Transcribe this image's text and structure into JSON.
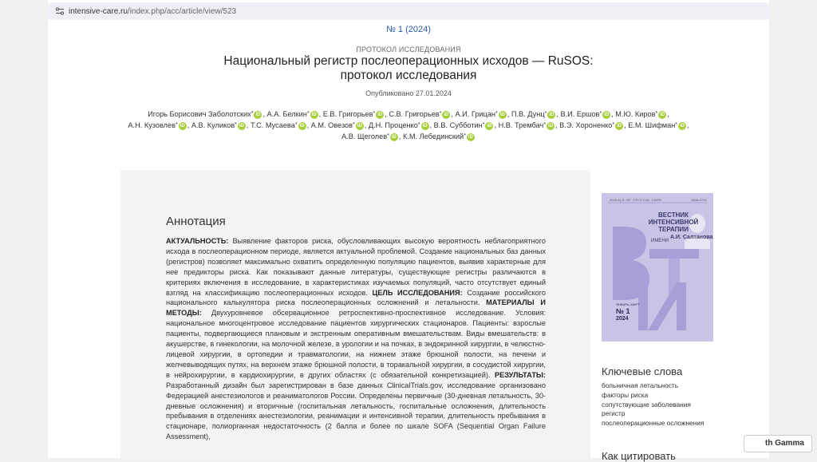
{
  "browser": {
    "url_host": "intensive-care.ru",
    "url_path": "/index.php/acc/article/view/523",
    "tune_icon": "tune-icon"
  },
  "article": {
    "issue": "№ 1 (2024)",
    "section": "ПРОТОКОЛ ИССЛЕДОВАНИЯ",
    "title": "Национальный регистр послеоперационных исходов — RuSOS: протокол исследования",
    "published": "Опубликовано 27.01.2024",
    "authors": [
      "Игорь Борисович Заболотских",
      "А.А. Белкин",
      "Е.В. Григорьев",
      "С.В. Григорьев",
      "А.И. Грицан",
      "П.В. Дунц",
      "В.И. Ершов",
      "М.Ю. Киров",
      "А.Н. Кузовлев",
      "А.В. Куликов",
      "Т.С. Мусаева",
      "А.М. Овезов",
      "Д.Н. Проценко",
      "В.В. Субботин",
      "Н.В. Трембач",
      "В.Э. Хороненко",
      "Е.М. Шифман",
      "А.В. Щеголев",
      "К.М. Лебединский"
    ],
    "orcid_label": "iD"
  },
  "abstract": {
    "heading": "Аннотация",
    "relevance_label": "АКТУАЛЬНОСТЬ:",
    "relevance_text": " Выявление факторов риска, обусловливающих высокую вероятность неблагоприятного исхода в послеоперационном периоде, является актуальной проблемой. Создание национальных баз данных (регистров) позволяет максимально охватить определенную популяцию пациентов, выявив характерные для нее предикторы риска. Как показывают данные литературы, существующие регистры различаются в критериях включения в исследование, в характеристиках изучаемых популяций, часто отсутствует единый взгляд на классификацию послеоперационных исходов. ",
    "goal_label": "ЦЕЛЬ ИССЛЕДОВАНИЯ:",
    "goal_text": " Создание российского национального калькулятора риска послеоперационных осложнений и летальности. ",
    "methods_label": "МАТЕРИАЛЫ И МЕТОДЫ:",
    "methods_text": " Двухуровневое обсервационное ретроспективно-проспективное исследование. Условия: национальное многоцентровое исследование пациентов хирургических стационаров. Пациенты: взрослые пациенты, подвергающиеся плановым и экстренным оперативным вмешательствам. Виды вмешательств: в акушерстве, в гинекологии, на молочной железе, в урологии и на почках, в эндокринной хирургии, в челюстно-лицевой хирургии, в ортопедии и травматологии, на нижнем этаже брюшной полости, на печени и желчевыводящих путях, на верхнем этаже брюшной полости, в торакальной хирургии, в сосудистой хирургии, в нейрохирургии, в кардиохирургии, в других областях (с обязательной конкретизацией). ",
    "results_label": "РЕЗУЛЬТАТЫ:",
    "results_text": " Разработанный дизайн был зарегистрирован в базе данных ClinicalTrials.gov, исследование организовано Федерацией анестезиологов и реаниматологов России. Определены первичные (30-дневная летальность, 30-дневные осложнения) и вторичные (госпитальная летальность, госпитальные осложнения, длительность пребывания в отделениях анестезиологии, реанимации и интенсивной терапии, длительность пребывания в стационаре, полиорганная недостаточность (2 балла и более по шкале SOFA (Sequential Organ Failure Assessment),"
  },
  "cover": {
    "eng_title": "ANNALS OF CRITICAL CARE",
    "issn": "1818-474X",
    "journal_name": "ВЕСТНИК ИНТЕНСИВНОЙ ТЕРАПИИ",
    "named": "ИМЕНИ",
    "named_person": "А.И. Салтанова",
    "period": "ЯНВАРЬ–МАРТ",
    "number": "№ 1",
    "year": "2024",
    "colors": {
      "background": "#c9c3e6",
      "letters": "#a89fd8"
    }
  },
  "keywords": {
    "heading": "Ключевые слова",
    "items": [
      "больничная летальность",
      "факторы риска",
      "сопутствующие заболевания",
      "регистр",
      "послеоперационные осложнения"
    ]
  },
  "next_heading": "Как цитировать",
  "gamma_badge": "th Gamma"
}
